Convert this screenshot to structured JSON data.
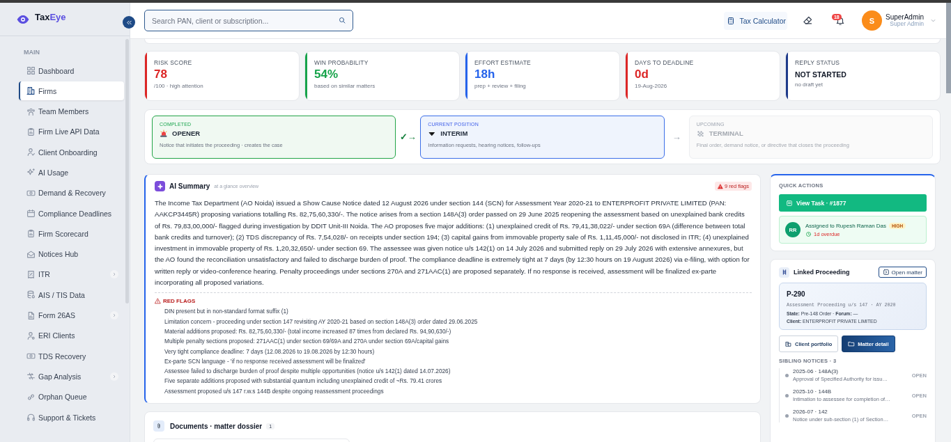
{
  "brand": {
    "part1": "Tax",
    "part2": "Eye"
  },
  "sidebar": {
    "section": "MAIN",
    "items": [
      {
        "label": "Dashboard",
        "selected": false,
        "expandable": false
      },
      {
        "label": "Firms",
        "selected": true,
        "expandable": false
      },
      {
        "label": "Team Members",
        "selected": false,
        "expandable": false
      },
      {
        "label": "Firm Live API Data",
        "selected": false,
        "expandable": false
      },
      {
        "label": "Client Onboarding",
        "selected": false,
        "expandable": false
      },
      {
        "label": "AI Usage",
        "selected": false,
        "expandable": false
      },
      {
        "label": "Demand & Recovery",
        "selected": false,
        "expandable": false
      },
      {
        "label": "Compliance Deadlines",
        "selected": false,
        "expandable": false
      },
      {
        "label": "Firm Scorecard",
        "selected": false,
        "expandable": false
      },
      {
        "label": "Notices Hub",
        "selected": false,
        "expandable": false
      },
      {
        "label": "ITR",
        "selected": false,
        "expandable": true
      },
      {
        "label": "AIS / TIS Data",
        "selected": false,
        "expandable": false
      },
      {
        "label": "Form 26AS",
        "selected": false,
        "expandable": true
      },
      {
        "label": "ERI Clients",
        "selected": false,
        "expandable": false
      },
      {
        "label": "TDS Recovery",
        "selected": false,
        "expandable": false
      },
      {
        "label": "Gap Analysis",
        "selected": false,
        "expandable": true
      },
      {
        "label": "Orphan Queue",
        "selected": false,
        "expandable": false
      },
      {
        "label": "Support & Tickets",
        "selected": false,
        "expandable": false
      }
    ]
  },
  "search": {
    "placeholder": "Search PAN, client or subscription..."
  },
  "header": {
    "tax_calculator": "Tax Calculator",
    "notifications": "18",
    "user": {
      "initial": "S",
      "name": "SuperAdmin",
      "role": "Super Admin"
    }
  },
  "metrics": [
    {
      "label": "RISK SCORE",
      "value": "78",
      "note": "/100 · high attention",
      "color": "#dc2626",
      "kind": "number"
    },
    {
      "label": "WIN PROBABILITY",
      "value": "54%",
      "note": "based on similar matters",
      "color": "#16a34a",
      "kind": "number"
    },
    {
      "label": "EFFORT ESTIMATE",
      "value": "18h",
      "note": "prep + review + filing",
      "color": "#2563eb",
      "kind": "number"
    },
    {
      "label": "DAYS TO DEADLINE",
      "value": "0d",
      "note": "19-Aug-2026",
      "color": "#dc2626",
      "kind": "number"
    },
    {
      "label": "REPLY STATUS",
      "value": "NOT STARTED",
      "note": "no draft yet",
      "color": "#1e3a8a",
      "kind": "status"
    }
  ],
  "stages": [
    {
      "kind": "completed",
      "status": "COMPLETED",
      "title": "OPENER",
      "description": "Notice that initiates the proceeding · creates the case"
    },
    {
      "kind": "current",
      "status": "CURRENT POSITION",
      "title": "INTERIM",
      "description": "Information requests, hearing notices, follow-ups"
    },
    {
      "kind": "upcoming",
      "status": "UPCOMING",
      "title": "TERMINAL",
      "description": "Final order, demand notice, or directive that closes the proceeding"
    }
  ],
  "connectors": [
    "✓→",
    "→"
  ],
  "ai_summary": {
    "title": "AI Summary",
    "subtitle": "at a glance overview",
    "flags_badge": "9 red flags",
    "text": "The Income Tax Department (AO Noida) issued a Show Cause Notice dated 12 August 2026 under section 144 (SCN) for Assessment Year 2020-21 to ENTERPROFIT PRIVATE LIMITED (PAN: AAKCP3445R) proposing variations totalling Rs. 82,75,60,330/-. The notice arises from a section 148A(3) order passed on 29 June 2025 reopening the assessment based on unexplained bank credits of Rs. 79,83,00,000/- flagged during investigation by DDIT Unit-III Noida. The AO proposes five major additions: (1) unexplained credit of Rs. 79,41,38,022/- under section 69A (difference between total bank credits and turnover); (2) TDS discrepancy of Rs. 7,54,028/- on receipts under section 194; (3) capital gains from immovable property sale of Rs. 1,11,45,000/- not disclosed in ITR; (4) unexplained investment in immovable property of Rs. 1,20,32,650/- under section 69. The assessee was given notice u/s 142(1) on 14 July 2026 and submitted reply on 29 July 2026 with extensive annexures, but the AO found the reconciliation unsatisfactory and failed to discharge burden of proof. The compliance deadline is extremely tight at 7 days (by 12:30 hours on 19 August 2026) via e-filing, with option for written reply or video-conference hearing. Penalty proceedings under sections 270A and 271AAC(1) are proposed separately. If no response is received, assessment will be finalized ex-parte incorporating all proposed variations.",
    "red_flags_title": "RED FLAGS",
    "red_flags": [
      "DIN present but in non-standard format suffix (1)",
      "Limitation concern - proceeding under section 147 revisiting AY 2020-21 based on section 148A(3) order dated 29.06.2025",
      "Material additions proposed: Rs. 82,75,60,330/- (total income increased 87 times from declared Rs. 94,90,630/-)",
      "Multiple penalty sections proposed: 271AAC(1) under section 69/69A and 270A under section 69A/capital gains",
      "Very tight compliance deadline: 7 days (12.08.2026 to 19.08.2026 by 12:30 hours)",
      "Ex-parte SCN language - 'if no response received assessment will be finalized'",
      "Assessee failed to discharge burden of proof despite multiple opportunities (notice u/s 142(1) dated 14.07.2026)",
      "Five separate additions proposed with substantial quantum including unexplained credit of ~Rs. 79.41 crores",
      "Assessment proposed u/s 147 r.w.s 144B despite ongoing reassessment proceedings"
    ]
  },
  "documents": {
    "title": "Documents · matter dossier",
    "count": "1"
  },
  "quick_actions": {
    "title": "QUICK ACTIONS",
    "view_task": "View Task · #1877",
    "initials": "RR",
    "assignment": "Assigned to Rupesh Raman Das",
    "priority": "HIGH",
    "due": "1d overdue"
  },
  "linked_proceeding": {
    "title": "Linked Proceeding",
    "open_matter": "Open matter",
    "id": "P-290",
    "description": "Assessment Proceeding u/s 147 · AY 2020",
    "state_line": "**State:** Pre-148 Order · **Forum:** —",
    "client_line": "**Client:** ENTERPROFIT PRIVATE LIMITED",
    "buttons": [
      {
        "label": "Client portfolio",
        "kind": "outline"
      },
      {
        "label": "Matter detail",
        "kind": "primary"
      }
    ],
    "siblings_title": "SIBLING NOTICES · 3",
    "siblings": [
      {
        "title": "2025-06 · 148A(3)",
        "description": "Approval of Specified Authority for issu…",
        "status": "OPEN"
      },
      {
        "title": "2025-10 · 144B",
        "description": "Intimation to assessee for completion of…",
        "status": "OPEN"
      },
      {
        "title": "2026-07 · 142",
        "description": "Notice under sub-section (1) of Section…",
        "status": "OPEN"
      }
    ]
  }
}
